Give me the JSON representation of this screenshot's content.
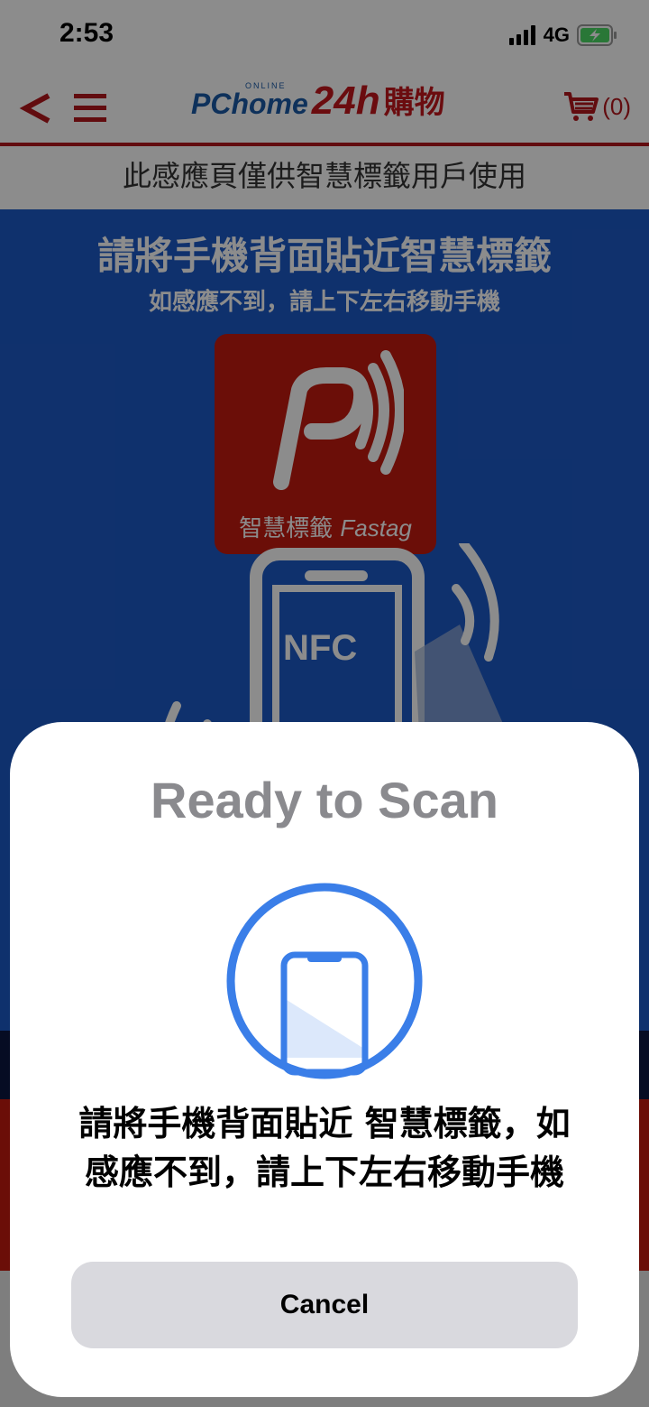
{
  "status_bar": {
    "time": "2:53",
    "network": "4G"
  },
  "header": {
    "brand_online": "ONLINE",
    "brand_name": "PChome",
    "brand_24h": "24h",
    "brand_shop": "購物",
    "cart_count": "(0)"
  },
  "notice": "此感應頁僅供智慧標籤用戶使用",
  "hero": {
    "title": "請將手機背面貼近智慧標籤",
    "subtitle": "如感應不到，請上下左右移動手機",
    "fastag_label": "智慧標籤",
    "fastag_label_en": "Fastag",
    "nfc_label": "NFC"
  },
  "scan_sheet": {
    "title": "Ready to Scan",
    "message": "請將手機背面貼近 智慧標籤，如感應不到，請上下左右移動手機",
    "cancel_label": "Cancel"
  },
  "colors": {
    "brand_red": "#c41a10",
    "hero_blue": "#1d59c7",
    "scan_blue": "#3a7ee8"
  }
}
